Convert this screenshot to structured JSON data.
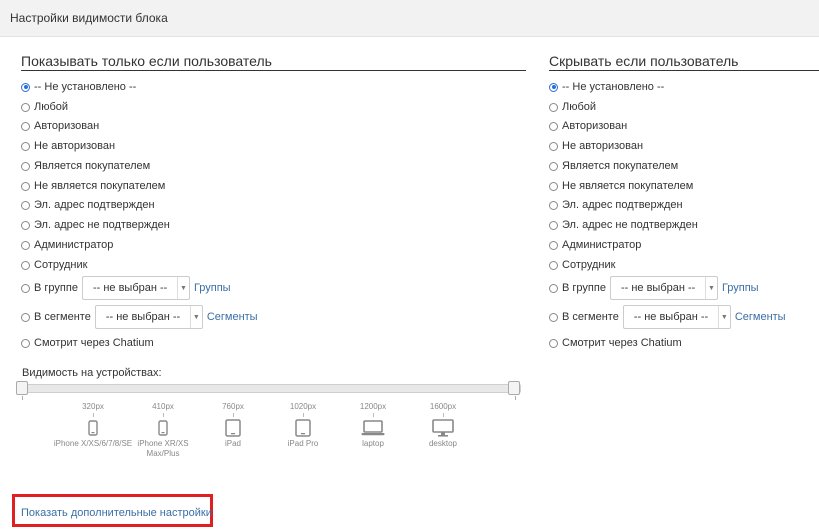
{
  "header": {
    "title": "Настройки видимости блока"
  },
  "left": {
    "title": "Показывать только если пользователь",
    "options": [
      "-- Не установлено --",
      "Любой",
      "Авторизован",
      "Не авторизован",
      "Является покупателем",
      "Не является покупателем",
      "Эл. адрес подтвержден",
      "Эл. адрес не подтвержден",
      "Администратор",
      "Сотрудник"
    ],
    "group_label": "В группе",
    "group_select": "-- не выбран --",
    "group_link": "Группы",
    "segment_label": "В сегменте",
    "segment_select": "-- не выбран --",
    "segment_link": "Сегменты",
    "chatium_label": "Смотрит через Chatium"
  },
  "right": {
    "title": "Скрывать если пользователь",
    "options": [
      "-- Не установлено --",
      "Любой",
      "Авторизован",
      "Не авторизован",
      "Является покупателем",
      "Не является покупателем",
      "Эл. адрес подтвержден",
      "Эл. адрес не подтвержден",
      "Администратор",
      "Сотрудник"
    ],
    "group_label": "В группе",
    "group_select": "-- не выбран --",
    "group_link": "Группы",
    "segment_label": "В сегменте",
    "segment_select": "-- не выбран --",
    "segment_link": "Сегменты",
    "chatium_label": "Смотрит через Chatium"
  },
  "devices": {
    "label": "Видимость на устройствах:",
    "range": {
      "from": 0,
      "to": 1
    },
    "items": [
      {
        "px": "320px",
        "name": "iPhone X/XS/6/7/8/SE",
        "icon": "smartphone-icon"
      },
      {
        "px": "410px",
        "name": "iPhone XR/XS Max/Plus",
        "icon": "smartphone-icon"
      },
      {
        "px": "760px",
        "name": "iPad",
        "icon": "tablet-icon"
      },
      {
        "px": "1020px",
        "name": "iPad Pro",
        "icon": "tablet-icon"
      },
      {
        "px": "1200px",
        "name": "laptop",
        "icon": "laptop-icon"
      },
      {
        "px": "1600px",
        "name": "desktop",
        "icon": "desktop-icon"
      }
    ]
  },
  "footer": {
    "show_more": "Показать дополнительные настройки"
  },
  "colors": {
    "accent": "#2a6fd6",
    "link": "#3a6ea5",
    "highlight": "#e02020"
  }
}
